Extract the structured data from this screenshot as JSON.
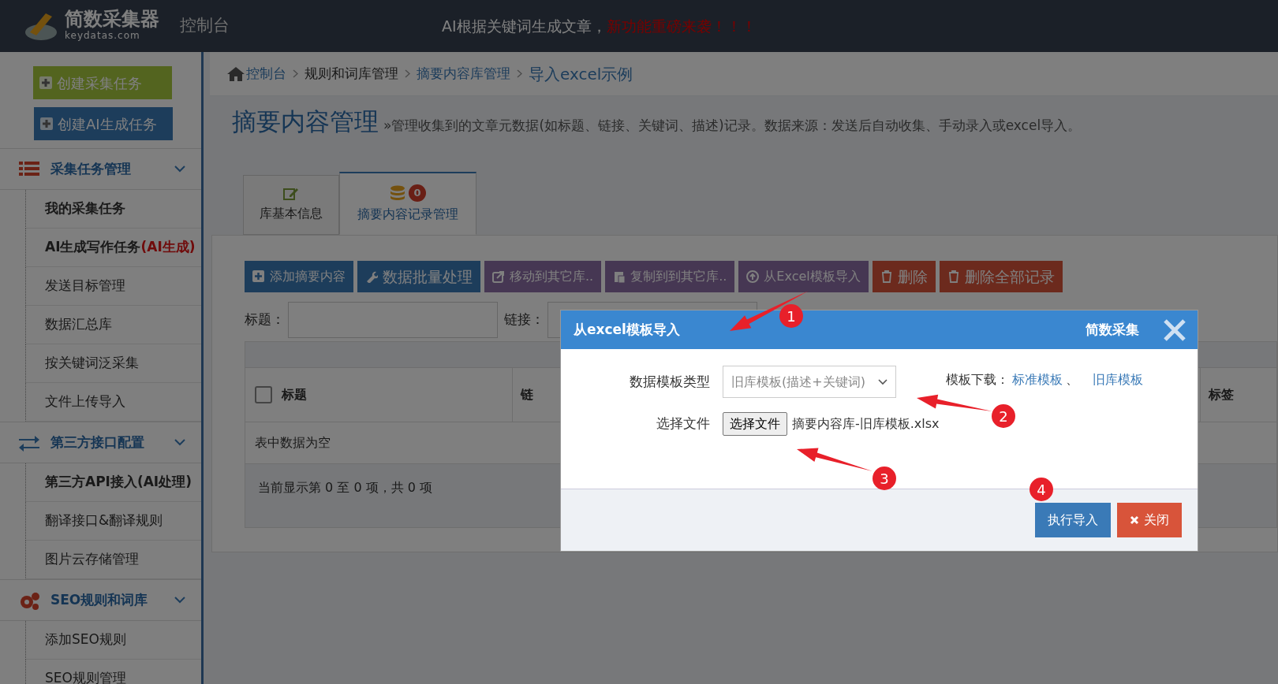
{
  "header": {
    "logo_text": "简数采集器",
    "logo_sub": "keydatas.com",
    "console": "控制台",
    "notice": "AI根据关键词生成文章，",
    "notice_highlight": "新功能重磅来袭！！！"
  },
  "sidebar": {
    "buttons": [
      {
        "label": "创建采集任务",
        "kind": "success"
      },
      {
        "label": "创建AI生成任务",
        "kind": "primary"
      }
    ],
    "sections": [
      {
        "title": "采集任务管理",
        "items": [
          {
            "label": "我的采集任务",
            "emphasized": true
          },
          {
            "label": "AI生成写作任务",
            "tag": "(AI生成)",
            "emphasized": true
          },
          {
            "label": "发送目标管理",
            "emphasized": false
          },
          {
            "label": "数据汇总库",
            "emphasized": false
          },
          {
            "label": "按关键词泛采集",
            "emphasized": false
          },
          {
            "label": "文件上传导入",
            "emphasized": false
          }
        ]
      },
      {
        "title": "第三方接口配置",
        "items": [
          {
            "label": "第三方API接入(AI处理)",
            "emphasized": true
          },
          {
            "label": "翻译接口&翻译规则",
            "emphasized": false
          },
          {
            "label": "图片云存储管理",
            "emphasized": false
          }
        ]
      },
      {
        "title": "SEO规则和词库",
        "items": [
          {
            "label": "添加SEO规则",
            "emphasized": false
          },
          {
            "label": "SEO规则管理",
            "emphasized": false
          }
        ]
      }
    ]
  },
  "breadcrumb": [
    {
      "label": "控制台",
      "kind": "home"
    },
    {
      "label": "规则和词库管理",
      "kind": "plain"
    },
    {
      "label": "摘要内容库管理",
      "kind": "link"
    },
    {
      "label": "导入excel示例",
      "kind": "current"
    }
  ],
  "page_title": "摘要内容管理",
  "page_subtitle": "»管理收集到的文章元数据(如标题、链接、关键词、描述)记录。数据来源：发送后自动收集、手动录入或excel导入。",
  "tabs": [
    {
      "label": "库基本信息",
      "selected": false
    },
    {
      "label": "摘要内容记录管理",
      "badge": "0",
      "selected": true
    }
  ],
  "toolbar": [
    {
      "label": "添加摘要内容",
      "kind": "primary"
    },
    {
      "label": "数据批量处理",
      "kind": "primary"
    },
    {
      "label": "移动到其它库..",
      "kind": "purple"
    },
    {
      "label": "复制到到其它库..",
      "kind": "purple"
    },
    {
      "label": "从Excel模板导入",
      "kind": "purple"
    },
    {
      "label": "删除",
      "kind": "danger"
    },
    {
      "label": "删除全部记录",
      "kind": "danger"
    }
  ],
  "filters": [
    {
      "label": "标题："
    },
    {
      "label": "链接："
    }
  ],
  "table": {
    "select_all_checked": false,
    "columns": [
      "标题",
      "链",
      "标签"
    ],
    "empty": "表中数据为空",
    "info": "当前显示第 0 至 0 项，共 0 项"
  },
  "modal": {
    "title": "从excel模板导入",
    "brand": "简数采集",
    "fields": [
      {
        "label": "数据模板类型",
        "kind": "select",
        "value": "旧库模板(描述+关键词)"
      },
      {
        "label": "选择文件",
        "kind": "file",
        "button": "选择文件",
        "value": "摘要内容库-旧库模板.xlsx"
      }
    ],
    "download": {
      "label": "模板下载：",
      "links": [
        "标准模板",
        "旧库模板"
      ],
      "separator": "、"
    },
    "buttons": [
      {
        "label": "执行导入",
        "kind": "primary"
      },
      {
        "label": "关闭",
        "kind": "danger"
      }
    ]
  },
  "annotations": [
    {
      "label": "1"
    },
    {
      "label": "2"
    },
    {
      "label": "3"
    },
    {
      "label": "4"
    }
  ]
}
